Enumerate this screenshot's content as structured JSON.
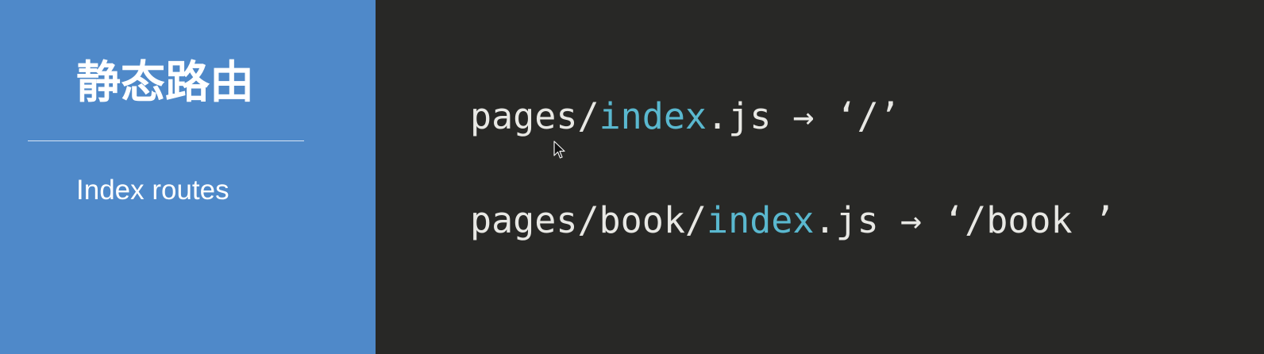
{
  "sidebar": {
    "title": "静态路由",
    "subtitle": "Index routes"
  },
  "code_lines": [
    {
      "prefix": "pages/",
      "highlight": "index",
      "suffix": ".js → ‘/’"
    },
    {
      "prefix": "pages/book/",
      "highlight": "index",
      "suffix": ".js → ‘/book ’"
    }
  ],
  "colors": {
    "left_panel_bg": "#4f89c9",
    "right_panel_bg": "#282826",
    "code_text": "#e8e8e4",
    "code_highlight": "#5ab8cf",
    "title_text": "#ffffff"
  },
  "icons": {
    "cursor": "mouse-pointer-icon"
  }
}
